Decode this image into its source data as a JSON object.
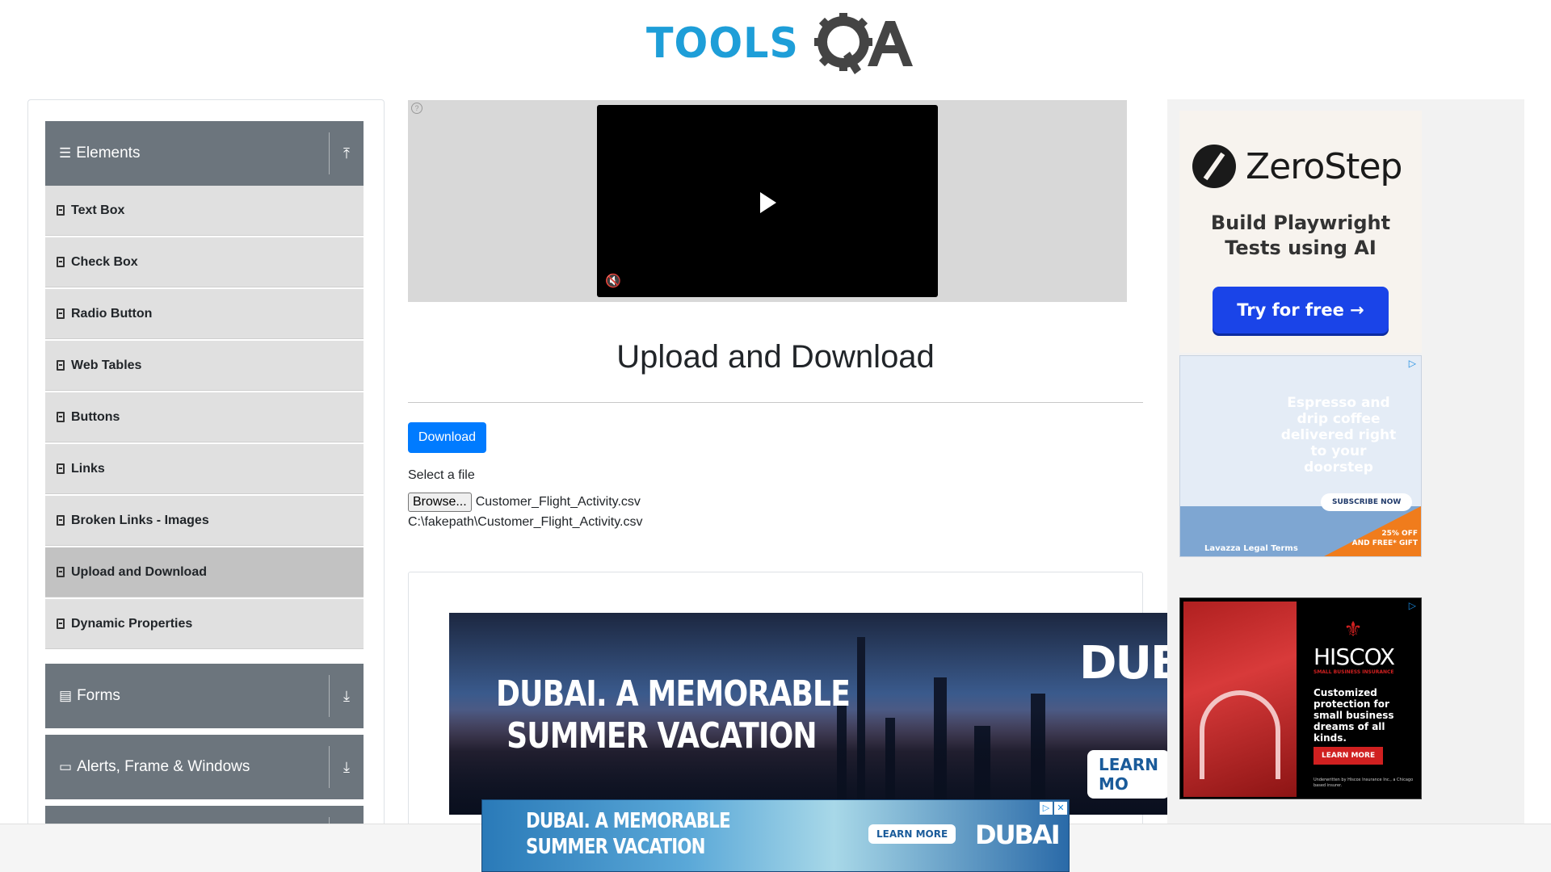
{
  "header": {
    "logo_text": "TOOLS",
    "logo_suffix": "QA"
  },
  "sidebar": {
    "groups": [
      {
        "label": "Elements",
        "expanded": true
      },
      {
        "label": "Forms",
        "expanded": false
      },
      {
        "label": "Alerts, Frame & Windows",
        "expanded": false
      }
    ],
    "items": [
      {
        "label": "Text Box"
      },
      {
        "label": "Check Box"
      },
      {
        "label": "Radio Button"
      },
      {
        "label": "Web Tables"
      },
      {
        "label": "Buttons"
      },
      {
        "label": "Links"
      },
      {
        "label": "Broken Links - Images"
      },
      {
        "label": "Upload and Download",
        "active": true
      },
      {
        "label": "Dynamic Properties"
      }
    ]
  },
  "main": {
    "title": "Upload and Download",
    "download_label": "Download",
    "select_label": "Select a file",
    "browse_label": "Browse...",
    "file_name": "Customer_Flight_Activity.csv",
    "uploaded_path": "C:\\fakepath\\Customer_Flight_Activity.csv"
  },
  "ads": {
    "dubai": {
      "headline_1": "DUBAI. A MEMORABLE",
      "headline_2": "SUMMER VACATION",
      "logo": "DUBAI",
      "cta": "LEARN MO"
    },
    "zerostep": {
      "name": "ZeroStep",
      "tagline_1": "Build Playwright",
      "tagline_2": "Tests using AI",
      "cta": "Try for free →"
    },
    "lavazza": {
      "copy": "Espresso and drip coffee delivered right to your doorstep",
      "cta": "SUBSCRIBE NOW",
      "legal": "Lavazza Legal Terms",
      "offer_1": "25% OFF",
      "offer_2": "AND FREE* GIFT"
    },
    "hiscox": {
      "name": "HISCOX",
      "small": "SMALL BUSINESS INSURANCE",
      "copy": "Customized protection for small business dreams of all kinds.",
      "cta": "LEARN MORE",
      "fine": "Underwritten by Hiscox Insurance Inc., a Chicago based insurer."
    },
    "bottom": {
      "headline_1": "DUBAI. A MEMORABLE",
      "headline_2": "SUMMER VACATION",
      "cta": "LEARN MORE",
      "logo": "DUBAI"
    }
  },
  "colors": {
    "brand_blue": "#1e9ed8",
    "primary": "#007bff",
    "sidebar_header": "#6c757d",
    "menu_item": "#e0e0e0",
    "menu_active": "#c2c2c2"
  }
}
